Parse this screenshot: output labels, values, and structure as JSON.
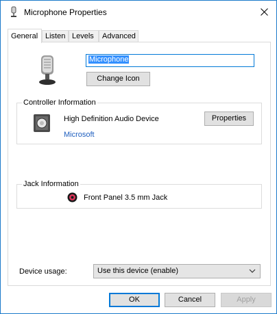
{
  "window": {
    "title": "Microphone Properties"
  },
  "tabs": [
    "General",
    "Listen",
    "Levels",
    "Advanced"
  ],
  "general": {
    "device_name": "Microphone",
    "change_icon_label": "Change Icon"
  },
  "controller": {
    "group_label": "Controller Information",
    "device": "High Definition Audio Device",
    "vendor": "Microsoft",
    "properties_label": "Properties"
  },
  "jack": {
    "group_label": "Jack Information",
    "jack_text": "Front Panel 3.5 mm Jack",
    "jack_color": "#e0345a"
  },
  "usage": {
    "label": "Device usage:",
    "selected": "Use this device (enable)"
  },
  "footer": {
    "ok": "OK",
    "cancel": "Cancel",
    "apply": "Apply"
  },
  "colors": {
    "accent": "#0078d7",
    "link": "#1f5fbf"
  }
}
